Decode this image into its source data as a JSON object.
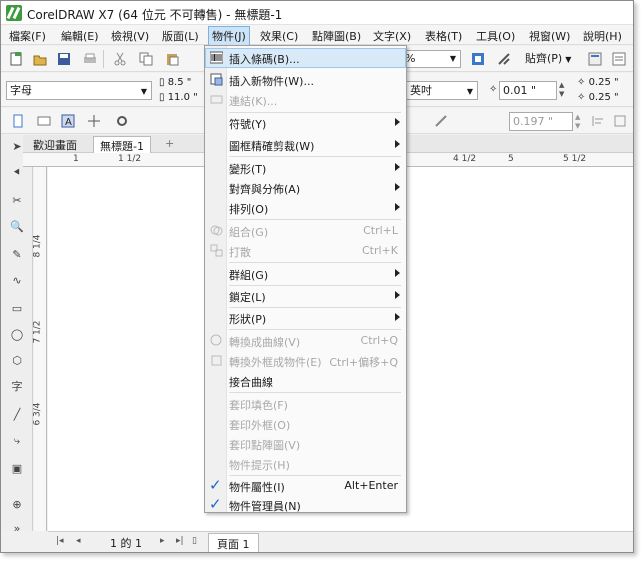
{
  "window": {
    "title": "CorelDRAW X7 (64 位元 不可轉售) - 無標題-1"
  },
  "menubar": [
    {
      "label": "檔案(F)"
    },
    {
      "label": "編輯(E)"
    },
    {
      "label": "檢視(V)"
    },
    {
      "label": "版面(L)"
    },
    {
      "label": "物件(J)"
    },
    {
      "label": "效果(C)"
    },
    {
      "label": "點陣圖(B)"
    },
    {
      "label": "文字(X)"
    },
    {
      "label": "表格(T)"
    },
    {
      "label": "工具(O)"
    },
    {
      "label": "視窗(W)"
    },
    {
      "label": "說明(H)"
    }
  ],
  "toolbar": {
    "zoom_value": "%",
    "snap_label": "貼齊(P)"
  },
  "property_bar": {
    "paper_size": "字母",
    "width": "8.5 \"",
    "height": "11.0 \"",
    "units": "英吋",
    "nudge": "0.01 \"",
    "dup_x": "0.25 \"",
    "dup_y": "0.25 \"",
    "outline_width": "0.197 \""
  },
  "tabs": [
    {
      "label": "歡迎畫面"
    },
    {
      "label": "無標題-1"
    }
  ],
  "ruler_h": [
    "1",
    "1 1/2",
    "4 1/2",
    "5",
    "5 1/2"
  ],
  "ruler_v": [
    "8 1/4",
    "7 1/2",
    "6 3/4"
  ],
  "status": {
    "page_count": "1 的 1",
    "page_tab": "頁面 1"
  },
  "menu": {
    "items": [
      {
        "label": "插入條碼(B)...",
        "icon": "barcode-icon",
        "enabled": true,
        "highlight": true
      },
      {
        "label": "插入新物件(W)...",
        "icon": "new-object-icon",
        "enabled": true
      },
      {
        "label": "連結(K)...",
        "icon": "link-icon",
        "enabled": false
      },
      {
        "label": "符號(Y)",
        "submenu": true,
        "enabled": true
      },
      {
        "label": "圖框精確剪裁(W)",
        "submenu": true,
        "enabled": true
      },
      {
        "label": "變形(T)",
        "submenu": true,
        "enabled": true
      },
      {
        "label": "對齊與分佈(A)",
        "submenu": true,
        "enabled": true
      },
      {
        "label": "排列(O)",
        "submenu": true,
        "enabled": true
      },
      {
        "label": "組合(G)",
        "shortcut": "Ctrl+L",
        "icon": "combine-icon",
        "enabled": false
      },
      {
        "label": "打散",
        "shortcut": "Ctrl+K",
        "icon": "break-apart-icon",
        "enabled": false
      },
      {
        "label": "群組(G)",
        "submenu": true,
        "enabled": true
      },
      {
        "label": "鎖定(L)",
        "submenu": true,
        "enabled": true
      },
      {
        "label": "形狀(P)",
        "submenu": true,
        "enabled": true
      },
      {
        "label": "轉換成曲線(V)",
        "shortcut": "Ctrl+Q",
        "icon": "convert-curves-icon",
        "enabled": false
      },
      {
        "label": "轉換外框成物件(E)",
        "shortcut": "Ctrl+偏移+Q",
        "icon": "outline-object-icon",
        "enabled": false
      },
      {
        "label": "接合曲線",
        "enabled": true
      },
      {
        "label": "套印填色(F)",
        "enabled": false
      },
      {
        "label": "套印外框(O)",
        "enabled": false
      },
      {
        "label": "套印點陣圖(V)",
        "enabled": false
      },
      {
        "label": "物件提示(H)",
        "enabled": false
      },
      {
        "label": "物件屬性(I)",
        "shortcut": "Alt+Enter",
        "checked": true,
        "enabled": true
      },
      {
        "label": "物件管理員(N)",
        "checked": true,
        "enabled": true
      }
    ]
  }
}
